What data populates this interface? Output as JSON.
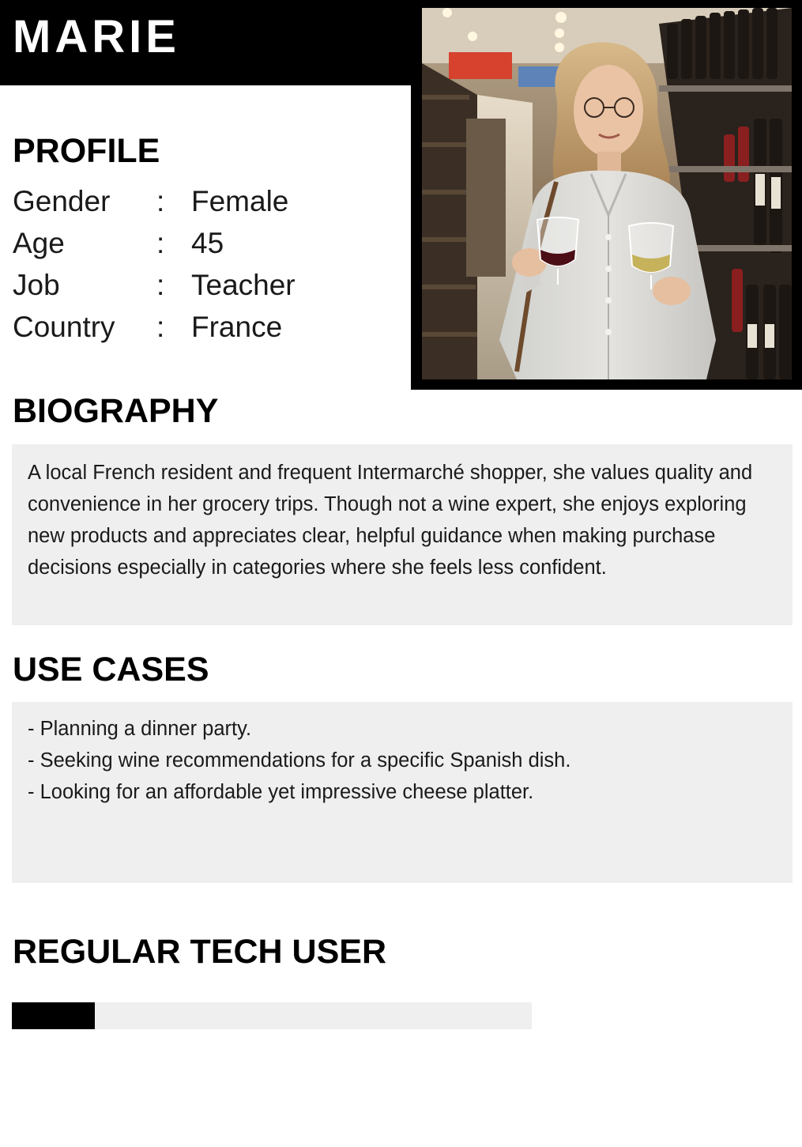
{
  "persona": {
    "name": "MARIE"
  },
  "profile": {
    "title": "PROFILE",
    "separator": ":",
    "rows": [
      {
        "label": "Gender",
        "value": "Female"
      },
      {
        "label": "Age",
        "value": "45"
      },
      {
        "label": "Job",
        "value": "Teacher"
      },
      {
        "label": "Country",
        "value": "France"
      }
    ]
  },
  "biography": {
    "title": "BIOGRAPHY",
    "text": "A local French resident and frequent Intermarché shopper, she values quality and convenience in her grocery trips. Though not a wine expert, she enjoys exploring new products and appreciates clear, helpful guidance when making purchase decisions especially in categories where she feels less confident."
  },
  "use_cases": {
    "title": "USE CASES",
    "items": [
      "- Planning a dinner party.",
      "- Seeking wine recommendations for a specific Spanish dish.",
      "- Looking for an affordable yet impressive cheese platter."
    ]
  },
  "tech": {
    "title": "REGULAR TECH USER",
    "level": 0.16
  },
  "colors": {
    "banner": "#000000",
    "panel": "#efefef",
    "fill": "#000000"
  }
}
